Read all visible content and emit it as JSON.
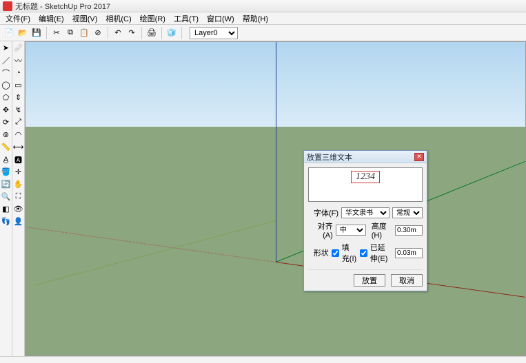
{
  "window": {
    "title": "无标题 - SketchUp Pro 2017"
  },
  "menu": {
    "items": [
      "文件(F)",
      "编辑(E)",
      "视图(V)",
      "相机(C)",
      "绘图(R)",
      "工具(T)",
      "窗口(W)",
      "帮助(H)"
    ]
  },
  "toolbar": {
    "layer_label": "Layer0"
  },
  "dialog": {
    "title": "放置三维文本",
    "preview_text": "1234",
    "font_label": "字体(F)",
    "font_value": "华文隶书",
    "style_value": "常规",
    "align_label": "对齐(A)",
    "align_value": "中",
    "height_label": "高度(H)",
    "height_value": "0.30m",
    "shape_label": "形状",
    "fill_label": "填充(I)",
    "extrude_label": "已延伸(E)",
    "extrude_value": "0.03m",
    "place_btn": "放置",
    "cancel_btn": "取消"
  }
}
